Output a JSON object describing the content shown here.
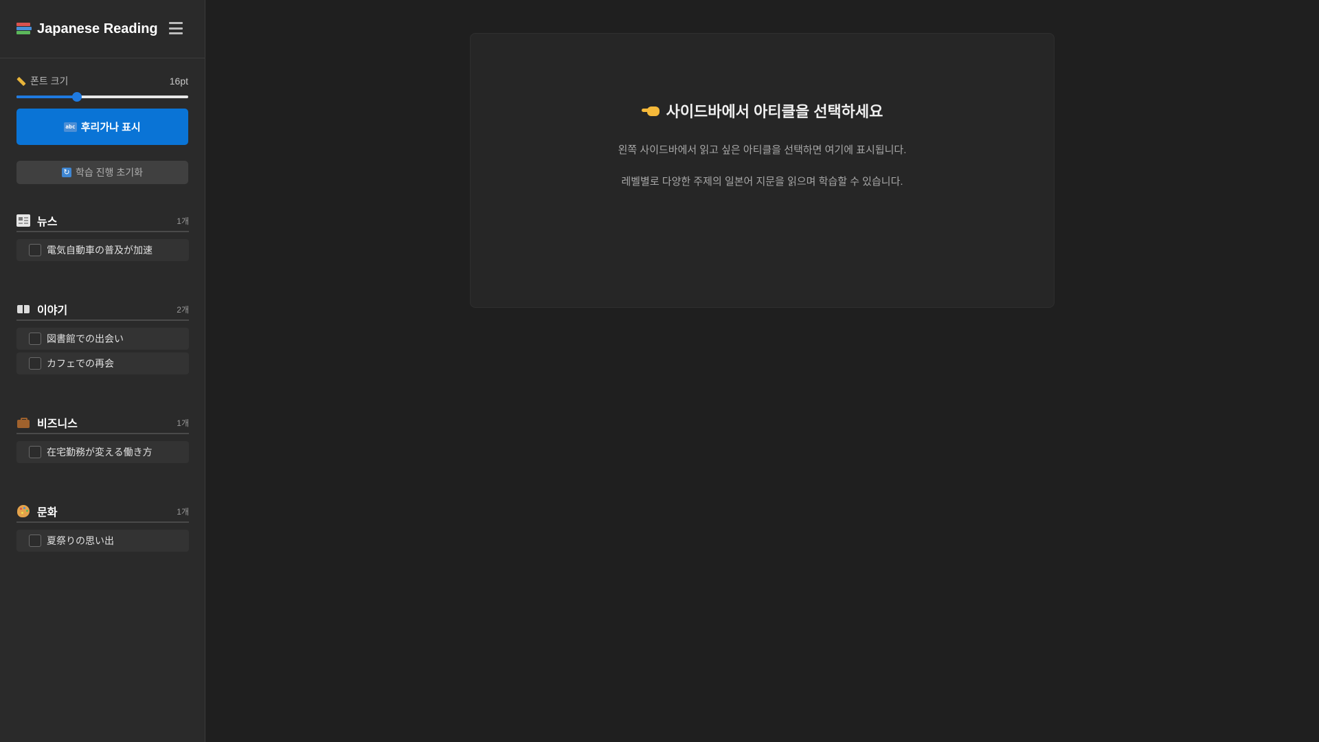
{
  "app": {
    "title": "Japanese Reading"
  },
  "controls": {
    "font_size_label": "폰트 크기",
    "font_size_value": "16pt",
    "font_size_slider": 0.35,
    "furigana_button": "후리가나 표시",
    "reset_button": "학습 진행 초기화"
  },
  "sections": [
    {
      "title": "뉴스",
      "count": "1개",
      "items": [
        {
          "label": "電気自動車の普及が加速"
        }
      ]
    },
    {
      "title": "이야기",
      "count": "2개",
      "items": [
        {
          "label": "図書館での出会い"
        },
        {
          "label": "カフェでの再会"
        }
      ]
    },
    {
      "title": "비즈니스",
      "count": "1개",
      "items": [
        {
          "label": "在宅勤務が変える働き方"
        }
      ]
    },
    {
      "title": "문화",
      "count": "1개",
      "items": [
        {
          "label": "夏祭りの思い出"
        }
      ]
    }
  ],
  "main": {
    "title": "사이드바에서 아티클을 선택하세요",
    "line1": "왼쪽 사이드바에서 읽고 싶은 아티클을 선택하면 여기에 표시됩니다.",
    "line2": "레벨별로 다양한 주제의 일본어 지문을 읽으며 학습할 수 있습니다."
  },
  "colors": {
    "accent": "#0a74d6",
    "sidebar_bg": "#2a2a2a",
    "main_bg": "#1f1f1f",
    "card_bg": "#262626"
  },
  "icons": {
    "brand": "books-icon",
    "menu": "hamburger-menu-icon",
    "font_size": "ruler-icon",
    "furigana": "abc-icon",
    "reset": "refresh-icon",
    "news": "newspaper-icon",
    "story": "open-book-icon",
    "business": "briefcase-icon",
    "culture": "palette-icon",
    "main_title": "pointing-hand-icon"
  }
}
